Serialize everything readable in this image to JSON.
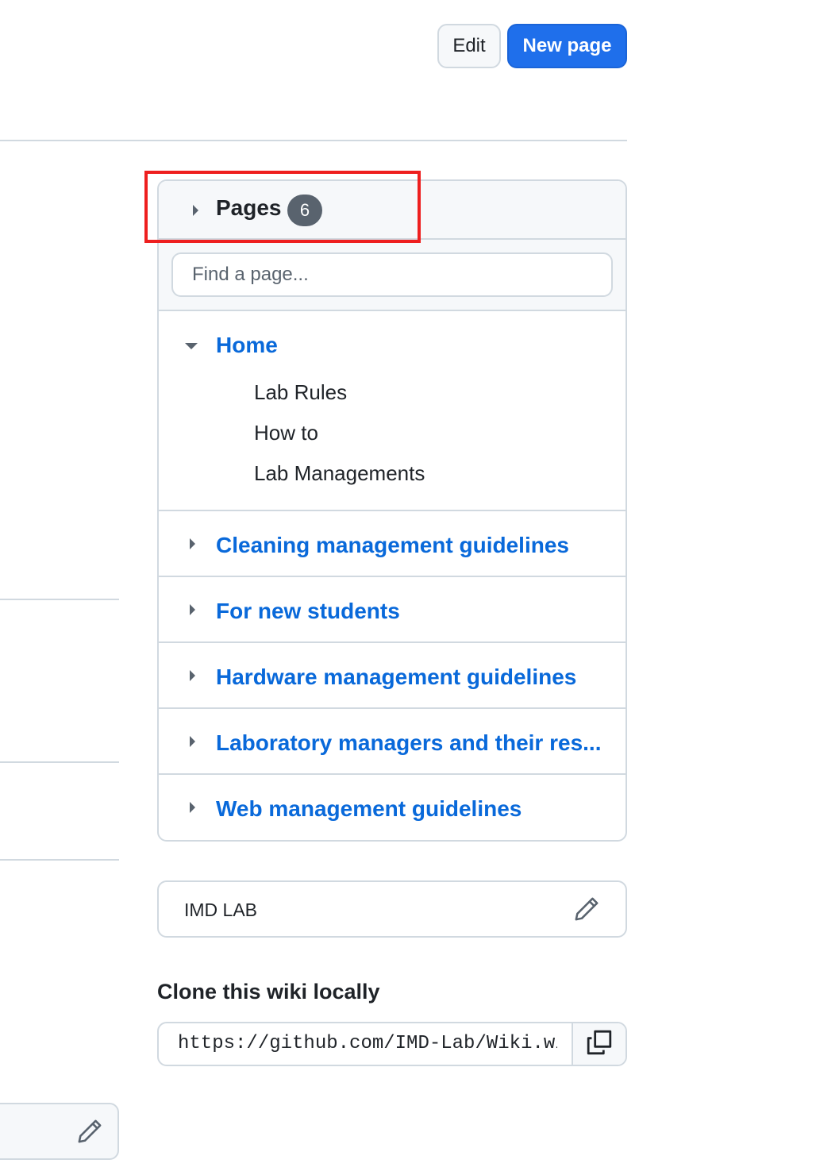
{
  "header": {
    "edit_label": "Edit",
    "new_page_label": "New page"
  },
  "pages": {
    "title": "Pages",
    "count": "6",
    "search_placeholder": "Find a page...",
    "home": {
      "label": "Home",
      "expanded": true,
      "children": [
        "Lab Rules",
        "How to",
        "Lab Managements"
      ]
    },
    "items": [
      "Cleaning management guidelines",
      "For new students",
      "Hardware management guidelines",
      "Laboratory managers and their res...",
      "Web management guidelines"
    ]
  },
  "footer": {
    "text": "IMD LAB"
  },
  "clone": {
    "title": "Clone this wiki locally",
    "url": "https://github.com/IMD-Lab/Wiki.wiki.git"
  },
  "colors": {
    "link": "#0969da",
    "primary_button": "#1f6feb",
    "highlight_box": "#ee1f1f",
    "border": "#d1d9e0"
  }
}
